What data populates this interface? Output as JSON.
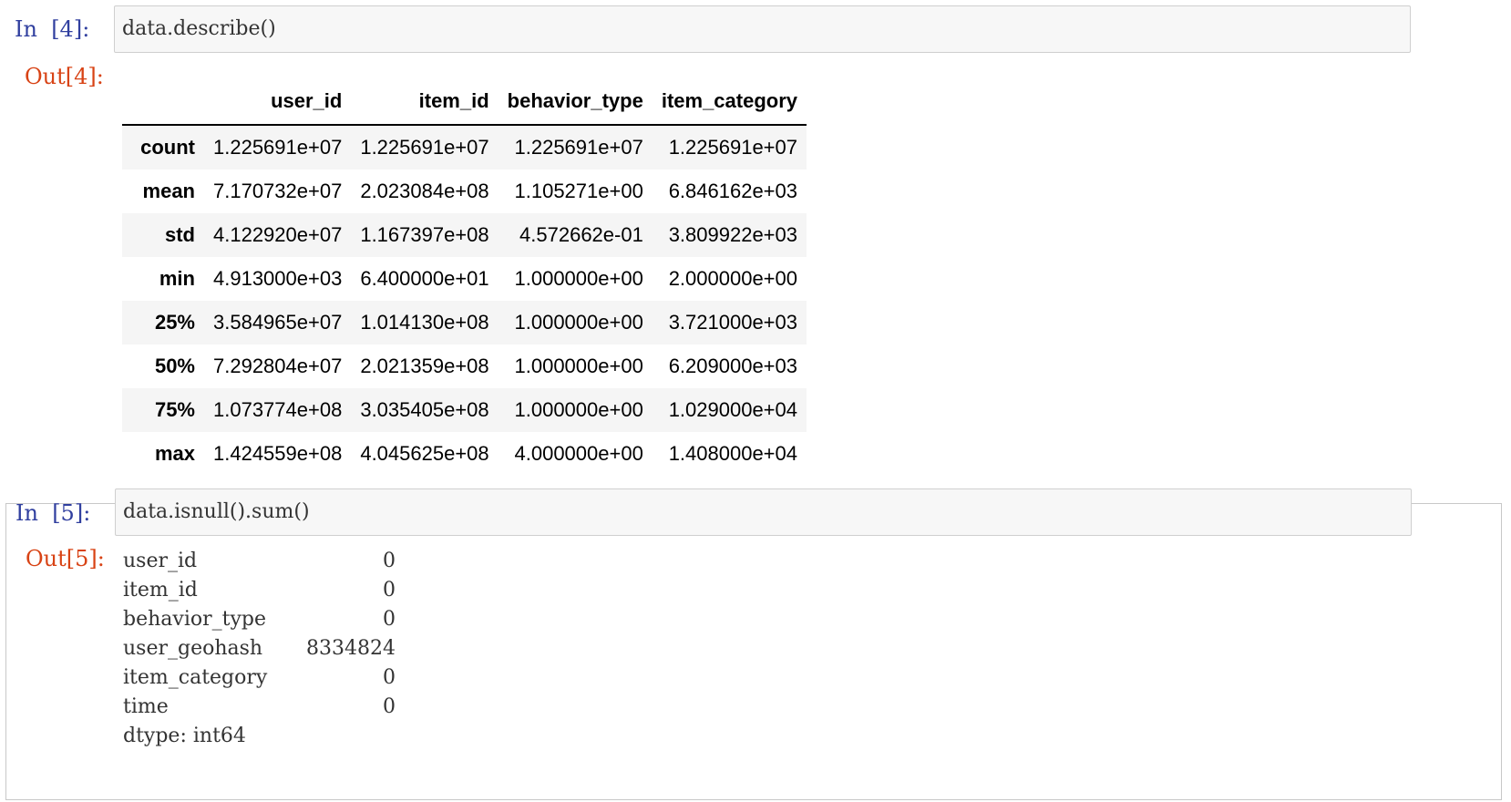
{
  "cell_4": {
    "in_prompt": "In  [4]:",
    "code": "data.describe()",
    "out_prompt": "Out[4]:",
    "table": {
      "columns": [
        "",
        "user_id",
        "item_id",
        "behavior_type",
        "item_category"
      ],
      "rows": [
        {
          "label": "count",
          "values": [
            "1.225691e+07",
            "1.225691e+07",
            "1.225691e+07",
            "1.225691e+07"
          ]
        },
        {
          "label": "mean",
          "values": [
            "7.170732e+07",
            "2.023084e+08",
            "1.105271e+00",
            "6.846162e+03"
          ]
        },
        {
          "label": "std",
          "values": [
            "4.122920e+07",
            "1.167397e+08",
            "4.572662e-01",
            "3.809922e+03"
          ]
        },
        {
          "label": "min",
          "values": [
            "4.913000e+03",
            "6.400000e+01",
            "1.000000e+00",
            "2.000000e+00"
          ]
        },
        {
          "label": "25%",
          "values": [
            "3.584965e+07",
            "1.014130e+08",
            "1.000000e+00",
            "3.721000e+03"
          ]
        },
        {
          "label": "50%",
          "values": [
            "7.292804e+07",
            "2.021359e+08",
            "1.000000e+00",
            "6.209000e+03"
          ]
        },
        {
          "label": "75%",
          "values": [
            "1.073774e+08",
            "3.035405e+08",
            "1.000000e+00",
            "1.029000e+04"
          ]
        },
        {
          "label": "max",
          "values": [
            "1.424559e+08",
            "4.045625e+08",
            "4.000000e+00",
            "1.408000e+04"
          ]
        }
      ]
    }
  },
  "cell_5": {
    "in_prompt": "In  [5]:",
    "code": "data.isnull().sum()",
    "out_prompt": "Out[5]:",
    "series": [
      {
        "key": "user_id",
        "value": "0"
      },
      {
        "key": "item_id",
        "value": "0"
      },
      {
        "key": "behavior_type",
        "value": "0"
      },
      {
        "key": "user_geohash",
        "value": "8334824"
      },
      {
        "key": "item_category",
        "value": "0"
      },
      {
        "key": "time",
        "value": "0"
      }
    ],
    "dtype_line": "dtype: int64"
  },
  "colors": {
    "in_prompt": "#303f9f",
    "out_prompt": "#d84315",
    "input_bg": "#f7f7f7"
  }
}
